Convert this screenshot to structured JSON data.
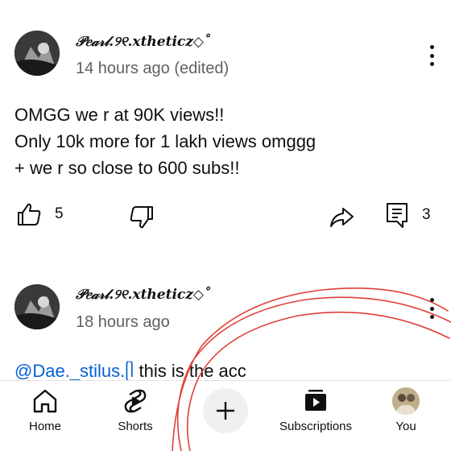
{
  "posts": [
    {
      "author": "𝒫𝑒𝒶𝓇𝓁.୨୧.xtheticz◇˚",
      "time": "14 hours ago (edited)",
      "lines": [
        "OMGG we r at 90K views!!",
        "Only 10k more for 1 lakh views omggg",
        "+ we r so close to 600 subs!!"
      ],
      "likes": "5",
      "replies": "3"
    },
    {
      "author": "𝒫𝑒𝒶𝓇𝓁.୨୧.xtheticz◇˚",
      "time": "18 hours ago",
      "mention": "@Dae._stilus.ᥫ",
      "text": " this is the acc"
    }
  ],
  "bottom_nav": {
    "home": "Home",
    "shorts": "Shorts",
    "subscriptions": "Subscriptions",
    "you": "You"
  },
  "colors": {
    "mention": "#065fd4",
    "secondary_text": "#606060",
    "annotation": "#e0403a"
  },
  "icons": [
    "like-icon",
    "dislike-icon",
    "share-icon",
    "comment-icon",
    "home-icon",
    "shorts-icon",
    "create-icon",
    "subscriptions-icon",
    "kebab-icon"
  ]
}
